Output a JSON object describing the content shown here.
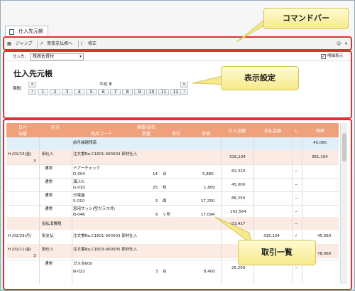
{
  "tab": {
    "label": "仕入先元帳"
  },
  "toolbar": {
    "jump": "ジャンプ",
    "purchase_payment": "買掛支払帳へ",
    "fix": "修正"
  },
  "settings": {
    "supplier_label": "仕入先:",
    "supplier_value": "株高佐資材",
    "show_detail_label": "明細表示",
    "show_detail_checked": "✓",
    "ledger_title": "仕入先元帳",
    "period_label": "期間:",
    "year": "平成 年",
    "months": [
      "1",
      "2",
      "3",
      "4",
      "5",
      "6",
      "7",
      "8",
      "9",
      "10",
      "11",
      "12"
    ]
  },
  "callouts": {
    "command_bar": "コマンドバー",
    "display_settings": "表示設定",
    "transactions": "取引一覧"
  },
  "table": {
    "headers": {
      "date": "日付",
      "type": "区分",
      "summary": "摘要/品名",
      "product_code": "商品コード",
      "qty": "数量",
      "unit": "単位",
      "price": "単価",
      "purchase_amount": "仕入金額",
      "payment_amount": "支払金額",
      "flag": "レ",
      "balance": "残高",
      "slip_no": "伝番"
    },
    "rows": [
      {
        "date": "",
        "type": "",
        "summary": "前月繰越残高",
        "code": "",
        "qty": "",
        "unit": "",
        "price": "",
        "purchase": "",
        "payment": "",
        "flag": "",
        "balance": "45,060"
      },
      {
        "date": "H /01/15(金)",
        "type": "掛仕入",
        "summary": "注文書No.C1601-000003 部材仕入",
        "code": "",
        "qty": "",
        "unit": "",
        "price": "",
        "purchase": "316,134",
        "payment": "",
        "flag": "",
        "balance": "361,194"
      },
      {
        "date": "3",
        "type": "",
        "summary": "",
        "code": "",
        "qty": "",
        "unit": "",
        "price": "",
        "purchase": "",
        "payment": "",
        "flag": "",
        "balance": ""
      },
      {
        "date": "",
        "type": "通常",
        "summary": "ドアーチェック",
        "code": "D-004",
        "qty": "14",
        "unit": "台",
        "price": "5,880",
        "purchase": "82,320",
        "payment": "",
        "flag": "−",
        "balance": ""
      },
      {
        "date": "",
        "type": "通常",
        "summary": "溝ふた",
        "code": "G-010",
        "qty": "25",
        "unit": "枚",
        "price": "1,800",
        "purchase": "45,000",
        "payment": "",
        "flag": "−",
        "balance": ""
      },
      {
        "date": "",
        "type": "通常",
        "summary": "分電盤",
        "code": "S-010",
        "qty": "5",
        "unit": "面",
        "price": "17,250",
        "purchase": "86,250",
        "payment": "",
        "flag": "−",
        "balance": ""
      },
      {
        "date": "",
        "type": "通常",
        "summary": "窓用サッシ(型ガラス共)",
        "code": "N-046",
        "qty": "6",
        "unit": "ヶ所",
        "price": "17,094",
        "purchase": "102,564",
        "payment": "",
        "flag": "−",
        "balance": ""
      },
      {
        "date": "",
        "type": "仮払消費税",
        "summary": "",
        "code": "",
        "qty": "",
        "unit": "",
        "price": "",
        "purchase": "(23,417",
        "payment": "",
        "flag": "−",
        "balance": ""
      },
      {
        "date": "H /02/29(月)",
        "type": "掛支払",
        "summary": "注文書No.C1601-000003 部材仕入",
        "code": "",
        "qty": "",
        "unit": "",
        "price": "",
        "purchase": "",
        "payment": "316,134",
        "flag": "✓",
        "balance": "45,060"
      },
      {
        "date": "H /01/11(金)",
        "type": "掛仕入",
        "summary": "注文書No.C1603-000005 部材仕入",
        "code": "",
        "qty": "",
        "unit": "",
        "price": "",
        "purchase": "",
        "payment": "",
        "flag": "",
        "balance": "78,060"
      },
      {
        "date": "3",
        "type": "",
        "summary": "",
        "code": "",
        "qty": "",
        "unit": "",
        "price": "",
        "purchase": "",
        "payment": "",
        "flag": "",
        "balance": ""
      },
      {
        "date": "",
        "type": "通常",
        "summary": "ガス台600",
        "code": "N-022",
        "qty": "3",
        "unit": "台",
        "price": "8,400",
        "purchase": "25,200",
        "payment": "",
        "flag": "−",
        "balance": ""
      }
    ]
  },
  "colors": {
    "header_bg": "#f0a07a",
    "callout_bg": "#f7ea8a",
    "highlight_border": "#e23030",
    "first_row_bg": "#dff0fb",
    "group_row_bg": "#fbebe3"
  }
}
